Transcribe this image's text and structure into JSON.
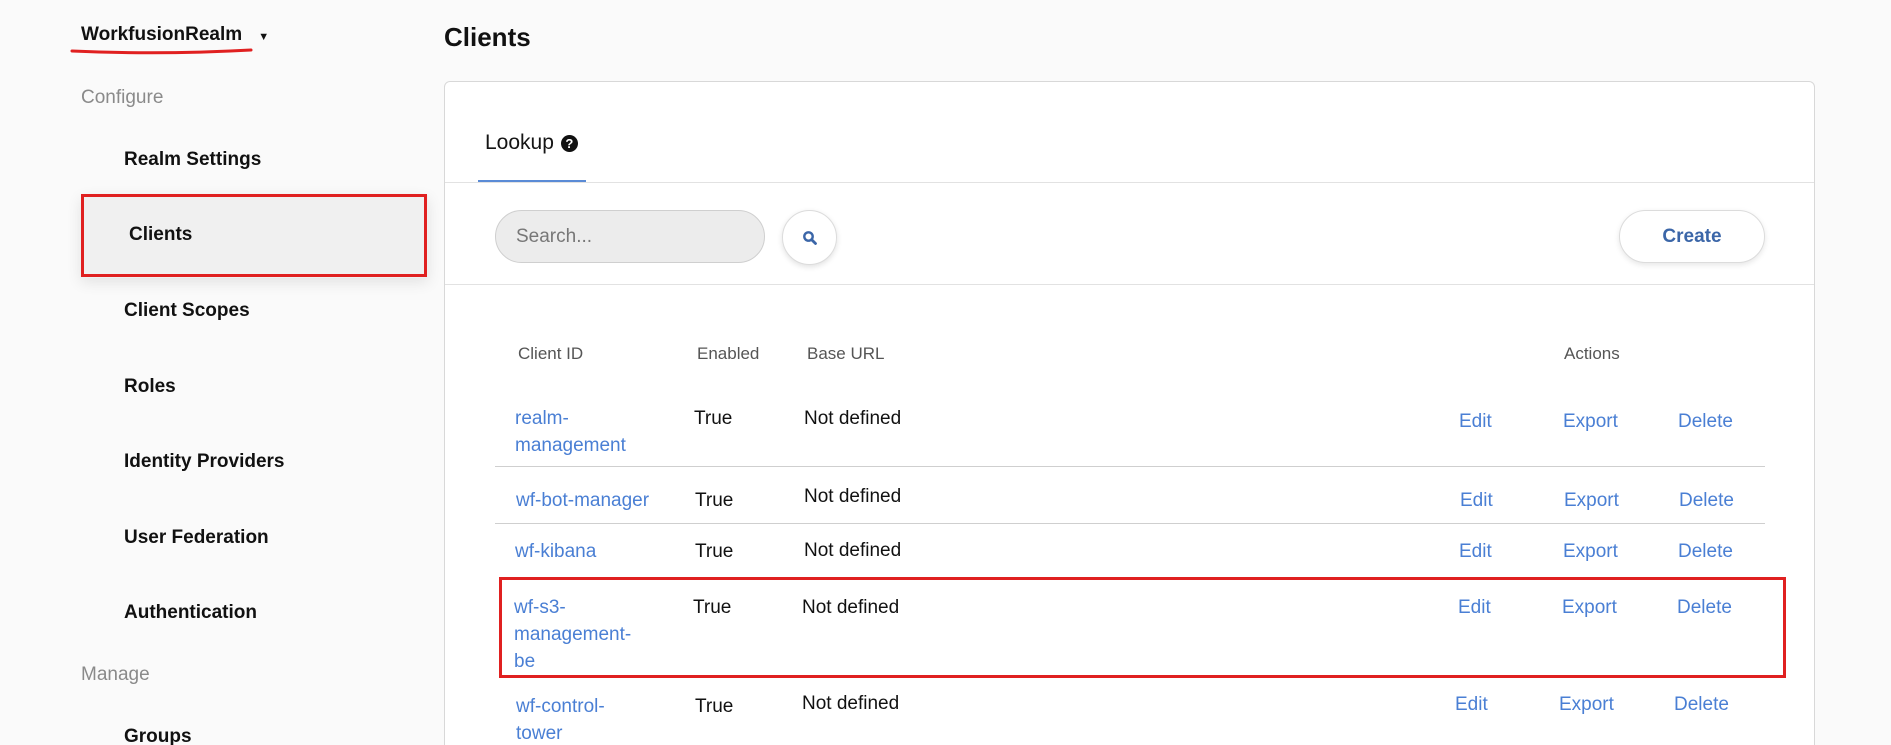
{
  "sidebar": {
    "realm_name": "WorkfusionRealm",
    "configure_label": "Configure",
    "manage_label": "Manage",
    "configure_items": [
      {
        "label": "Realm Settings"
      },
      {
        "label": "Clients"
      },
      {
        "label": "Client Scopes"
      },
      {
        "label": "Roles"
      },
      {
        "label": "Identity Providers"
      },
      {
        "label": "User Federation"
      },
      {
        "label": "Authentication"
      }
    ],
    "manage_items": [
      {
        "label": "Groups"
      }
    ]
  },
  "main": {
    "title": "Clients",
    "tab": {
      "label": "Lookup",
      "help_icon": "question-circle-icon"
    },
    "search": {
      "placeholder": "Search..."
    },
    "create_label": "Create",
    "table": {
      "headers": {
        "client_id": "Client ID",
        "enabled": "Enabled",
        "base_url": "Base URL",
        "actions": "Actions"
      },
      "rows": [
        {
          "client_id": "realm-management",
          "enabled": "True",
          "base_url": "Not defined",
          "edit": "Edit",
          "export": "Export",
          "delete": "Delete"
        },
        {
          "client_id": "wf-bot-manager",
          "enabled": "True",
          "base_url": "Not defined",
          "edit": "Edit",
          "export": "Export",
          "delete": "Delete"
        },
        {
          "client_id": "wf-kibana",
          "enabled": "True",
          "base_url": "Not defined",
          "edit": "Edit",
          "export": "Export",
          "delete": "Delete"
        },
        {
          "client_id": "wf-s3-management-be",
          "enabled": "True",
          "base_url": "Not defined",
          "edit": "Edit",
          "export": "Export",
          "delete": "Delete"
        },
        {
          "client_id": "wf-control-tower",
          "enabled": "True",
          "base_url": "Not defined",
          "edit": "Edit",
          "export": "Export",
          "delete": "Delete"
        }
      ]
    }
  },
  "colors": {
    "link": "#4a7fd4",
    "annotation": "#e02020",
    "create_text": "#3b66a8",
    "tab_underline": "#5a8bd6"
  }
}
